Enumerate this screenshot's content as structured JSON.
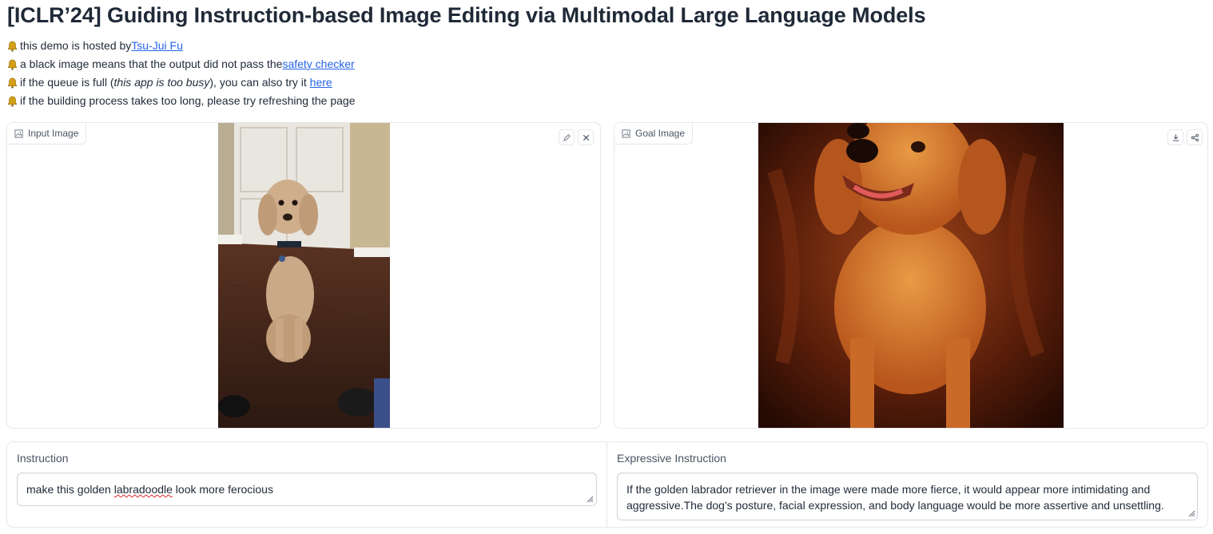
{
  "title": "[ICLR’24] Guiding Instruction-based Image Editing via Multimodal Large Language Models",
  "notes": {
    "n1_text": "this demo is hosted by ",
    "n1_link": "Tsu-Jui Fu",
    "n2_text": "a black image means that the output did not pass the ",
    "n2_link": "safety checker",
    "n3_text_a": "if the queue is full (",
    "n3_italic": "this app is too busy",
    "n3_text_b": "), you can also try it ",
    "n3_link": "here",
    "n4_text": "if the building process takes too long, please try refreshing the page",
    "icon": "bell-icon"
  },
  "input_image": {
    "label": "Input Image",
    "label_icon": "image-icon",
    "tools": [
      "pencil-icon",
      "close-icon"
    ]
  },
  "goal_image": {
    "label": "Goal Image",
    "label_icon": "image-icon",
    "tools": [
      "download-icon",
      "share-icon"
    ]
  },
  "instruction": {
    "label": "Instruction",
    "value_before": "make this golden ",
    "value_misspelled": "labradoodle",
    "value_after": " look more ferocious"
  },
  "expressive_instruction": {
    "label": "Expressive Instruction",
    "value": "If the golden labrador retriever in the image were made more fierce, it would appear more intimidating and aggressive.The dog's posture, facial expression, and body language would be more assertive and unsettling."
  },
  "colors": {
    "link": "#2563eb",
    "border": "#e5e7eb",
    "text": "#1f2937"
  }
}
